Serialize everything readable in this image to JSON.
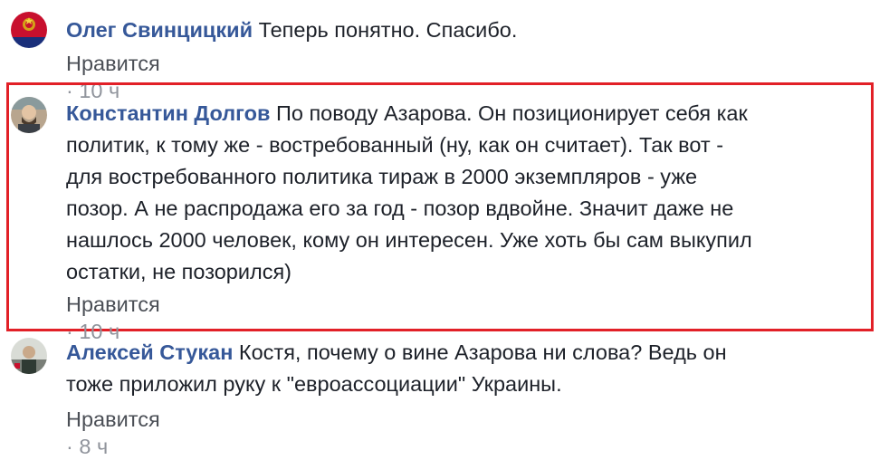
{
  "comments": [
    {
      "author": "Олег Свинцицкий",
      "lines": [
        "Теперь понятно. Спасибо."
      ],
      "like_label": "Нравится",
      "separator": "·",
      "time": "10 ч"
    },
    {
      "author": "Константин Долгов",
      "lines": [
        "По поводу Азарова. Он позиционирует себя как",
        "политик, к тому же - востребованный (ну, как он считает). Так вот -",
        "для востребованного политика тираж в 2000 экземпляров - уже",
        "позор. А не распродажа его за год - позор вдвойне. Значит даже не",
        "нашлось 2000 человек, кому он интересен. Уже хоть бы сам выкупил",
        "остатки, не позорился)"
      ],
      "like_label": "Нравится",
      "separator": "·",
      "time": "10 ч"
    },
    {
      "author": "Алексей Стукан",
      "lines": [
        "Костя, почему о вине Азарова ни слова? Ведь он",
        "тоже приложил руку к \"евроассоциации\" Украины."
      ],
      "like_label": "Нравится",
      "separator": "·",
      "time": "8 ч"
    }
  ],
  "colors": {
    "author_link": "#365899",
    "highlight_border": "#e22027",
    "meta_text": "#90949c"
  }
}
